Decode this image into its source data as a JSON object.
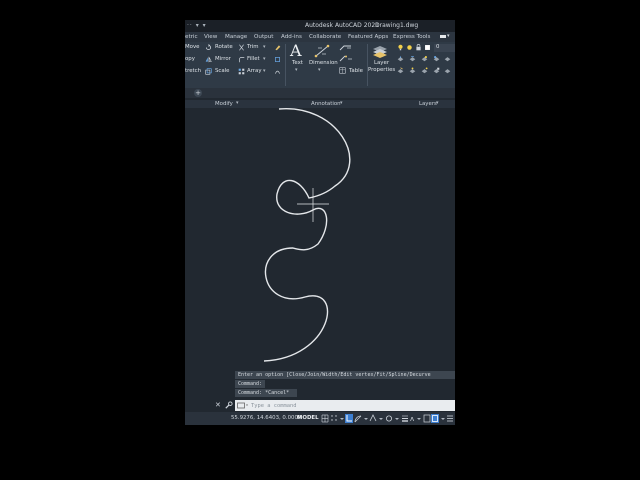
{
  "title_bar": {
    "quick_access": "·· ▾ ▾",
    "app_title": "Autodesk AutoCAD 2021",
    "doc_title": "Drawing1.dwg"
  },
  "ribbon_tabs": [
    "etric",
    "View",
    "Manage",
    "Output",
    "Add-ins",
    "Collaborate",
    "Featured Apps",
    "Express Tools"
  ],
  "modify_panel": {
    "col1": [
      "Move",
      "opy",
      "tretch"
    ],
    "col2": [
      "Rotate",
      "Mirror",
      "Scale"
    ],
    "col3": [
      "Trim",
      "Fillet",
      "Array"
    ],
    "title": "Modify"
  },
  "annotation_panel": {
    "text_label": "Text",
    "dimension_label": "Dimension",
    "table_label": "Table",
    "title": "Annotation"
  },
  "layers_panel": {
    "layer_properties_line1": "Layer",
    "layer_properties_line2": "Properties",
    "current_layer": "0",
    "title": "Layers"
  },
  "file_tabs": {
    "new_tab": "+"
  },
  "command_history": [
    "Enter an option [Close/Join/Width/Edit vertex/Fit/Spline/Decurve",
    "Command:",
    "Command: *Cancel*"
  ],
  "command_input": {
    "placeholder": "Type a command",
    "close": "✕"
  },
  "status_bar": {
    "coords": "55.9276, 14.6403, 0.0000",
    "model": "MODEL"
  },
  "colors": {
    "canvas_bg": "#212830",
    "ribbon_bg": "#2f3a46",
    "curve": "#e4e7ea",
    "accent_active": "#3d7fd1"
  }
}
